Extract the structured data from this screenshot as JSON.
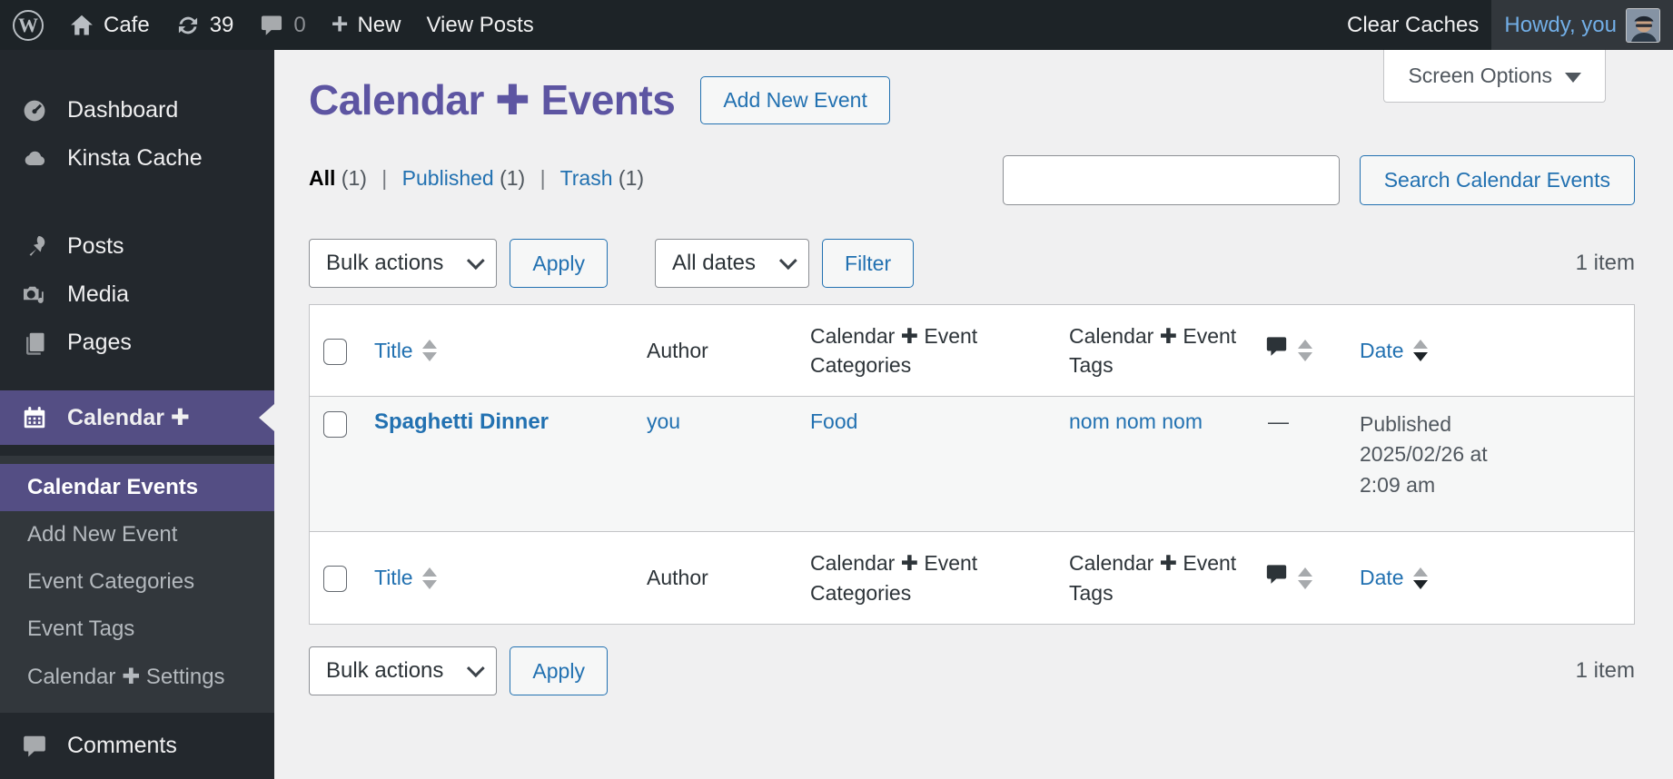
{
  "colors": {
    "admin_bar_bg": "#1d2327",
    "sidebar_bg": "#23282d",
    "submenu_bg": "#32373c",
    "accent_purple": "#544e84",
    "heading_purple": "#5d55a2",
    "link_blue": "#2271b1",
    "howdy_blue": "#72aee6",
    "content_bg": "#f0f0f1",
    "border_gray": "#c3c4c7"
  },
  "admin_bar": {
    "site_name": "Cafe",
    "updates_count": "39",
    "comments_count": "0",
    "new_label": "New",
    "view_posts": "View Posts",
    "clear_caches": "Clear Caches",
    "howdy": "Howdy, you"
  },
  "sidebar": {
    "items": [
      {
        "label": "Dashboard"
      },
      {
        "label": "Kinsta Cache"
      },
      {
        "label": "Posts"
      },
      {
        "label": "Media"
      },
      {
        "label": "Pages"
      },
      {
        "label": "Calendar ✚"
      },
      {
        "label": "Comments"
      }
    ],
    "submenu": [
      {
        "label": "Calendar Events"
      },
      {
        "label": "Add New Event"
      },
      {
        "label": "Event Categories"
      },
      {
        "label": "Event Tags"
      },
      {
        "label": "Calendar ✚ Settings"
      }
    ]
  },
  "page": {
    "screen_options": "Screen Options",
    "title": "Calendar ✚ Events",
    "add_new": "Add New Event",
    "filters": {
      "all": "All",
      "all_count": "(1)",
      "published": "Published",
      "published_count": "(1)",
      "trash": "Trash",
      "trash_count": "(1)"
    },
    "search_button": "Search Calendar Events",
    "toolbar": {
      "bulk_actions": "Bulk actions",
      "apply": "Apply",
      "all_dates": "All dates",
      "filter": "Filter",
      "item_count": "1 item"
    },
    "table": {
      "col_title": "Title",
      "col_author": "Author",
      "col_categories": "Calendar ✚ Event Categories",
      "col_tags": "Calendar ✚ Event Tags",
      "col_date": "Date",
      "row": {
        "title": "Spaghetti Dinner",
        "author": "you",
        "category": "Food",
        "tags": "nom nom nom",
        "comments_dash": "—",
        "status": "Published",
        "date": "2025/02/26 at 2:09 am"
      }
    }
  }
}
